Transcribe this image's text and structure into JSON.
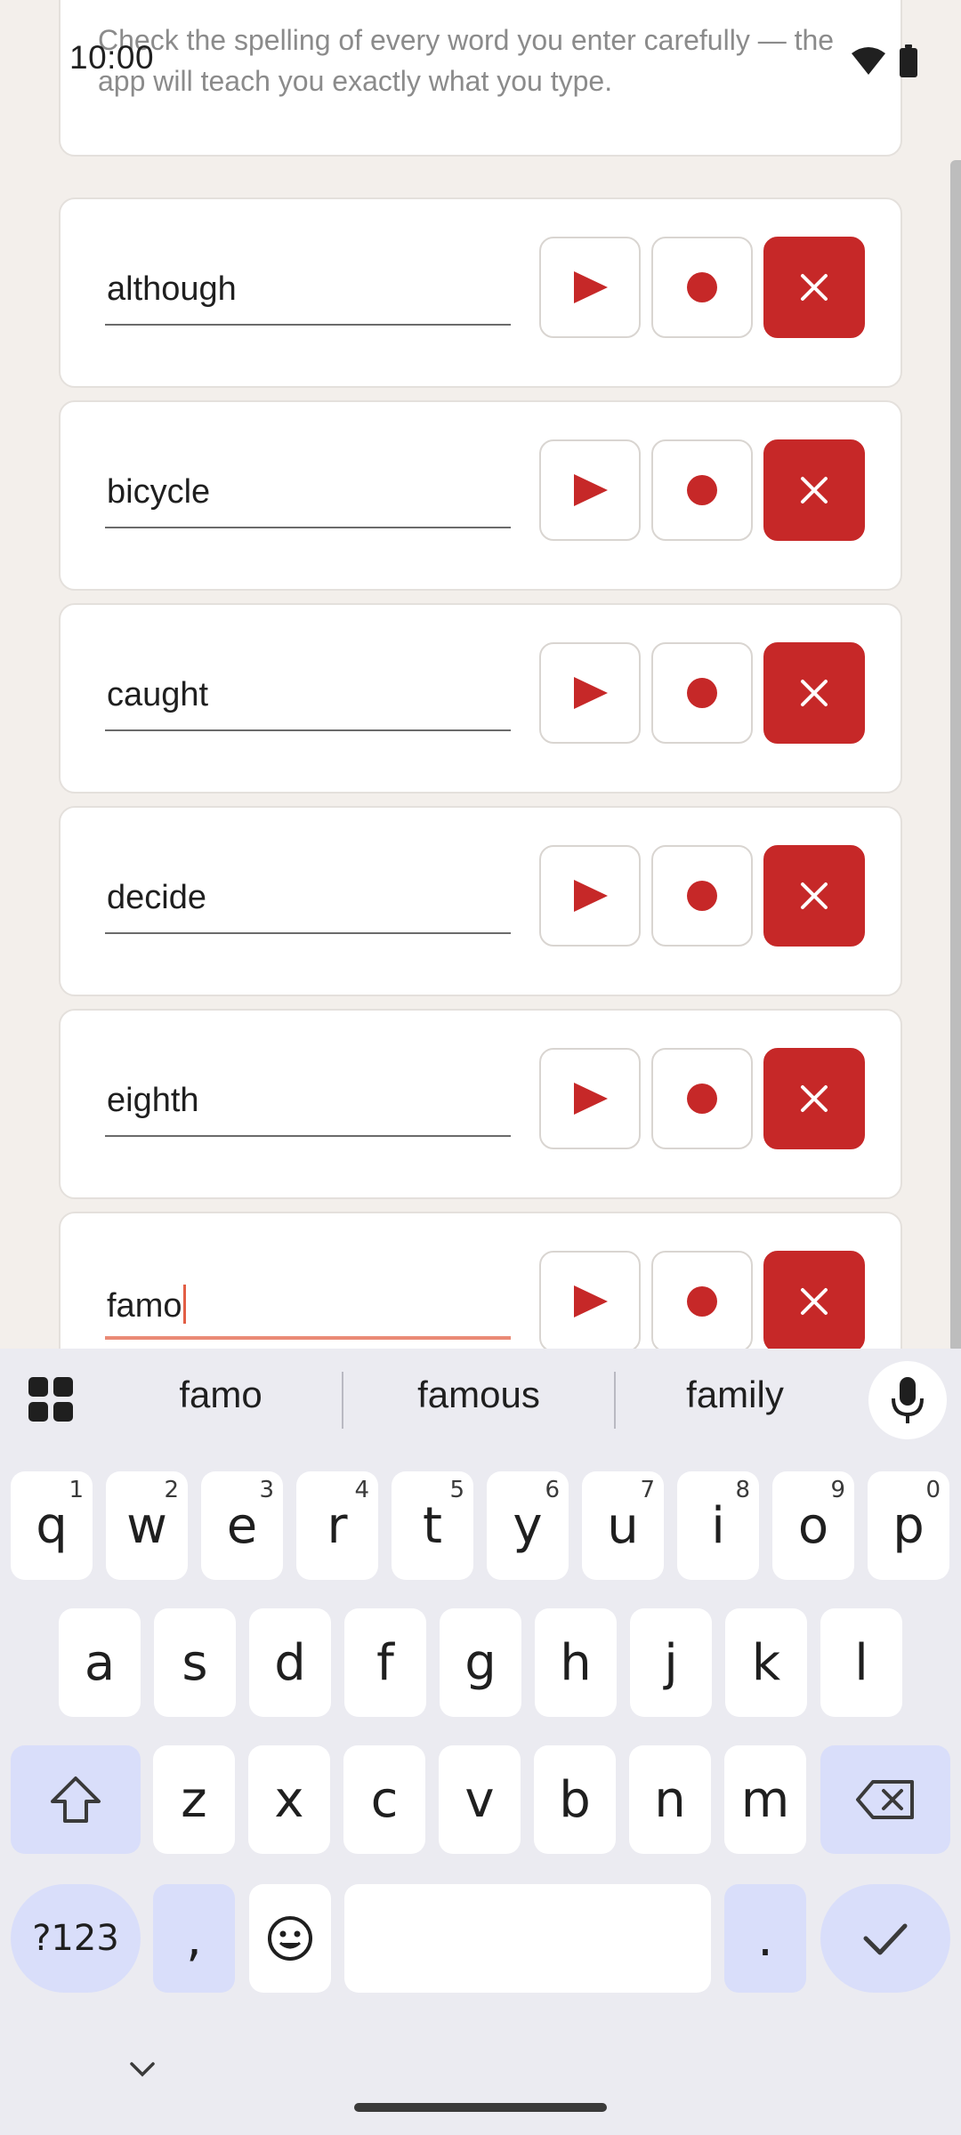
{
  "status_bar": {
    "time": "10:00"
  },
  "intro": {
    "text": "Check the spelling of every word you enter carefully — the app will teach you exactly what you type."
  },
  "words": [
    {
      "value": "although"
    },
    {
      "value": "bicycle"
    },
    {
      "value": "caught"
    },
    {
      "value": "decide"
    },
    {
      "value": "eighth"
    },
    {
      "value": "famo"
    }
  ],
  "buttons": {
    "play": "play-icon",
    "record": "record-icon",
    "delete": "close-icon"
  },
  "colors": {
    "accent_red": "#c62828",
    "background": "#f3efeb",
    "focus_underline": "#ea8a76"
  },
  "keyboard": {
    "suggestions": [
      "famo",
      "famous",
      "family"
    ],
    "row1": [
      {
        "k": "q",
        "h": "1"
      },
      {
        "k": "w",
        "h": "2"
      },
      {
        "k": "e",
        "h": "3"
      },
      {
        "k": "r",
        "h": "4"
      },
      {
        "k": "t",
        "h": "5"
      },
      {
        "k": "y",
        "h": "6"
      },
      {
        "k": "u",
        "h": "7"
      },
      {
        "k": "i",
        "h": "8"
      },
      {
        "k": "o",
        "h": "9"
      },
      {
        "k": "p",
        "h": "0"
      }
    ],
    "row2": [
      "a",
      "s",
      "d",
      "f",
      "g",
      "h",
      "j",
      "k",
      "l"
    ],
    "row3": [
      "z",
      "x",
      "c",
      "v",
      "b",
      "n",
      "m"
    ],
    "symbols_key": "?123",
    "comma_key": ",",
    "period_key": "."
  }
}
